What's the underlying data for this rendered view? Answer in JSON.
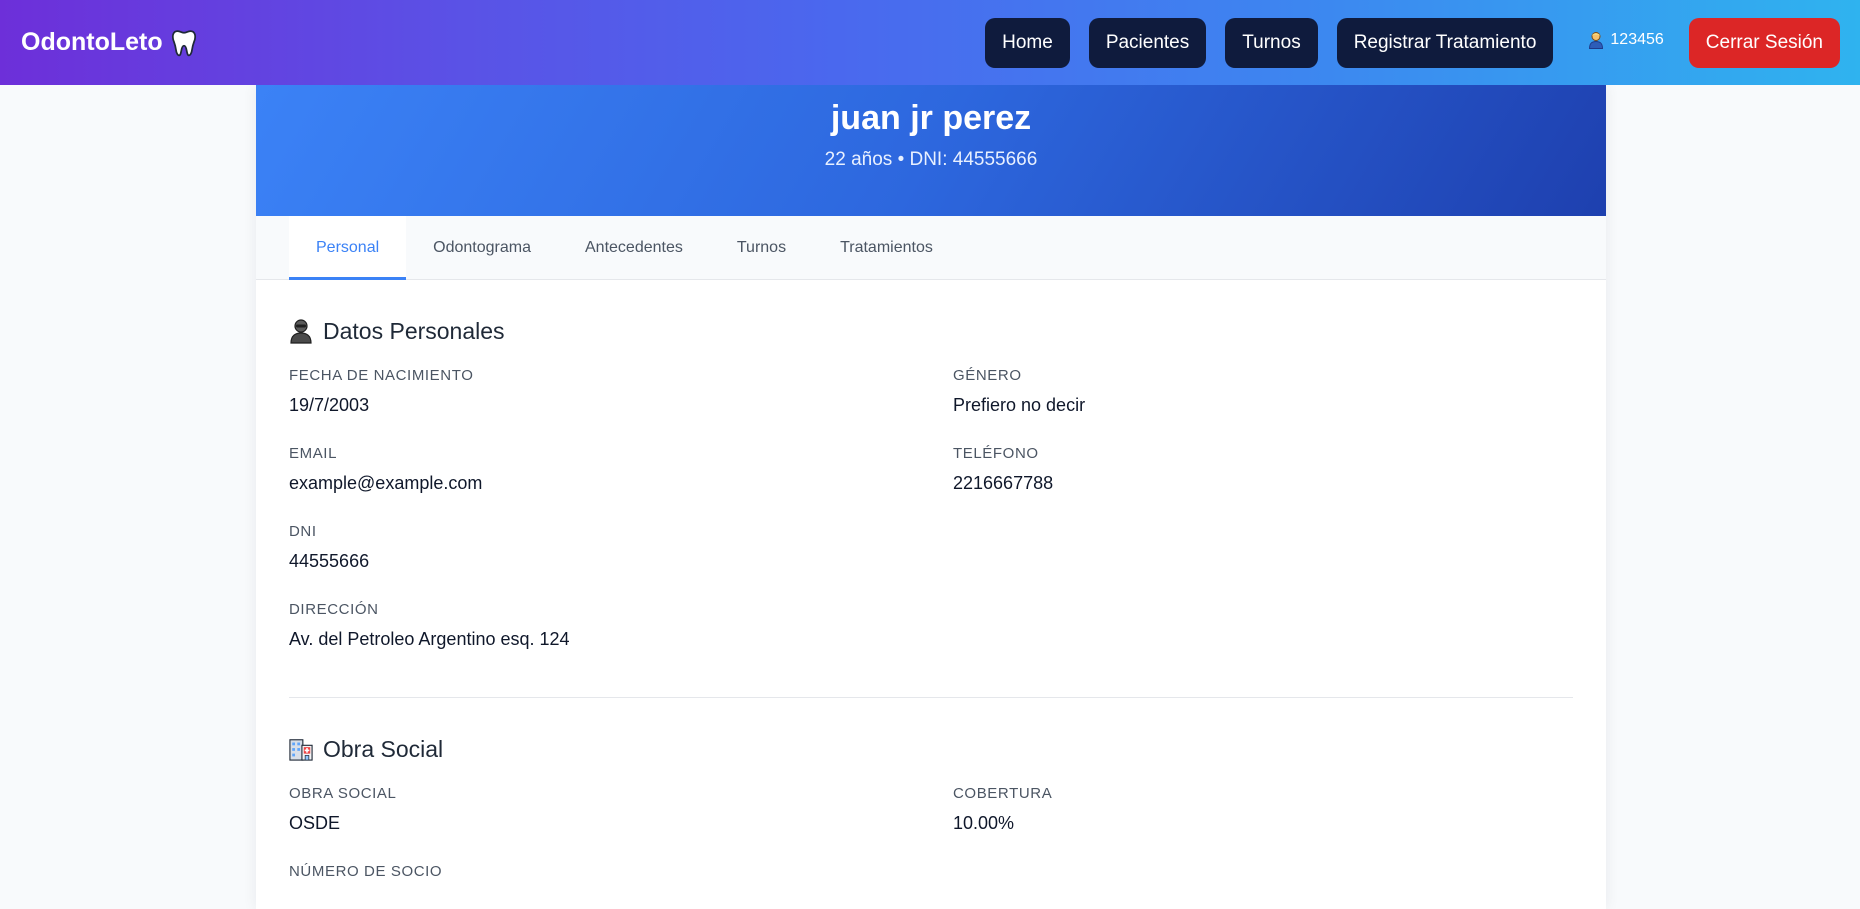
{
  "brand": {
    "name": "OdontoLeto",
    "icon": "tooth-icon"
  },
  "nav": {
    "items": [
      {
        "label": "Home"
      },
      {
        "label": "Pacientes"
      },
      {
        "label": "Turnos"
      },
      {
        "label": "Registrar Tratamiento"
      }
    ],
    "user": {
      "icon": "user-icon",
      "id": "123456"
    },
    "logout_label": "Cerrar Sesión"
  },
  "patient": {
    "name": "juan jr perez",
    "subtitle": "22 años • DNI: 44555666"
  },
  "tabs": [
    {
      "label": "Personal",
      "active": true
    },
    {
      "label": "Odontograma",
      "active": false
    },
    {
      "label": "Antecedentes",
      "active": false
    },
    {
      "label": "Turnos",
      "active": false
    },
    {
      "label": "Tratamientos",
      "active": false
    }
  ],
  "personal": {
    "title": "Datos Personales",
    "icon": "person-icon",
    "fields": {
      "birth": {
        "label": "Fecha de Nacimiento",
        "value": "19/7/2003"
      },
      "gender": {
        "label": "Género",
        "value": "Prefiero no decir"
      },
      "email": {
        "label": "Email",
        "value": "example@example.com"
      },
      "phone": {
        "label": "Teléfono",
        "value": "2216667788"
      },
      "dni": {
        "label": "DNI",
        "value": "44555666"
      },
      "address": {
        "label": "Dirección",
        "value": "Av. del Petroleo Argentino esq. 124"
      }
    }
  },
  "insurance": {
    "title": "Obra Social",
    "icon": "hospital-icon",
    "fields": {
      "name": {
        "label": "Obra Social",
        "value": "OSDE"
      },
      "coverage": {
        "label": "Cobertura",
        "value": "10.00%"
      },
      "member": {
        "label": "Número de Socio"
      }
    }
  },
  "colors": {
    "accent": "#3b82f6",
    "nav_button": "#0f1b3d",
    "logout": "#dc2626"
  }
}
